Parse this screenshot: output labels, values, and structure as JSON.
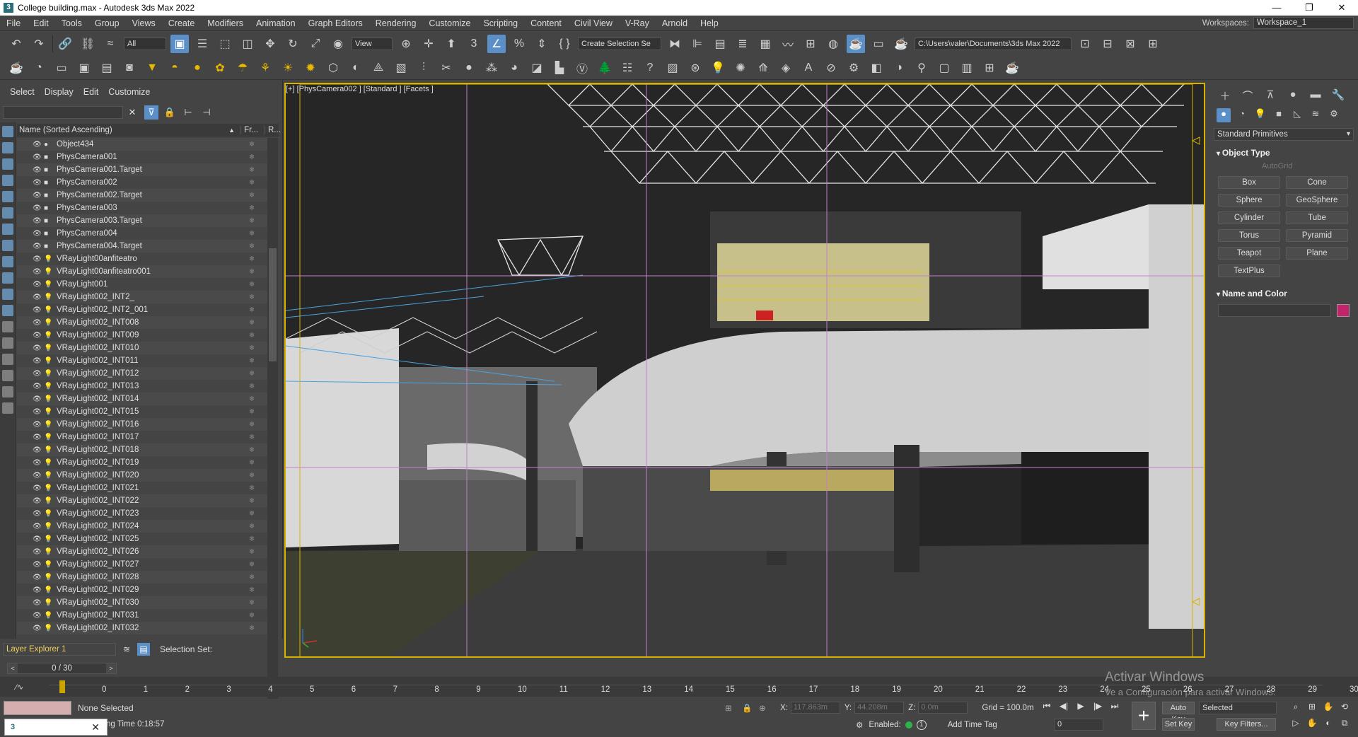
{
  "window": {
    "title": "College building.max - Autodesk 3ds Max 2022",
    "icon_label": "3",
    "controls": [
      "—",
      "❐",
      "✕"
    ]
  },
  "menu": {
    "items": [
      "File",
      "Edit",
      "Tools",
      "Group",
      "Views",
      "Create",
      "Modifiers",
      "Animation",
      "Graph Editors",
      "Rendering",
      "Customize",
      "Scripting",
      "Content",
      "Civil View",
      "V-Ray",
      "Arnold",
      "Help"
    ],
    "workspace_label": "Workspaces:",
    "workspace_value": "Workspace_1"
  },
  "toolbar": {
    "selection_filter": "All",
    "ref_coord": "View",
    "named_selection": "Create Selection Se",
    "project_path": "C:\\Users\\valer\\Documents\\3ds Max 2022"
  },
  "explorer": {
    "menu": [
      "Select",
      "Display",
      "Edit",
      "Customize"
    ],
    "search_value": "",
    "column_name": "Name (Sorted Ascending)",
    "column_frozen": "Fr...",
    "column_render": "R...",
    "rows": [
      {
        "name": "Object434",
        "kind": "geo"
      },
      {
        "name": "PhysCamera001",
        "kind": "cam"
      },
      {
        "name": "PhysCamera001.Target",
        "kind": "cam"
      },
      {
        "name": "PhysCamera002",
        "kind": "cam"
      },
      {
        "name": "PhysCamera002.Target",
        "kind": "cam"
      },
      {
        "name": "PhysCamera003",
        "kind": "cam"
      },
      {
        "name": "PhysCamera003.Target",
        "kind": "cam"
      },
      {
        "name": "PhysCamera004",
        "kind": "cam"
      },
      {
        "name": "PhysCamera004.Target",
        "kind": "cam"
      },
      {
        "name": "VRayLight00anfiteatro",
        "kind": "light"
      },
      {
        "name": "VRayLight00anfiteatro001",
        "kind": "light"
      },
      {
        "name": "VRayLight001",
        "kind": "light"
      },
      {
        "name": "VRayLight002_INT2_",
        "kind": "light"
      },
      {
        "name": "VRayLight002_INT2_001",
        "kind": "light"
      },
      {
        "name": "VRayLight002_INT008",
        "kind": "light"
      },
      {
        "name": "VRayLight002_INT009",
        "kind": "light"
      },
      {
        "name": "VRayLight002_INT010",
        "kind": "light"
      },
      {
        "name": "VRayLight002_INT011",
        "kind": "light"
      },
      {
        "name": "VRayLight002_INT012",
        "kind": "light"
      },
      {
        "name": "VRayLight002_INT013",
        "kind": "light"
      },
      {
        "name": "VRayLight002_INT014",
        "kind": "light"
      },
      {
        "name": "VRayLight002_INT015",
        "kind": "light"
      },
      {
        "name": "VRayLight002_INT016",
        "kind": "light"
      },
      {
        "name": "VRayLight002_INT017",
        "kind": "light"
      },
      {
        "name": "VRayLight002_INT018",
        "kind": "light"
      },
      {
        "name": "VRayLight002_INT019",
        "kind": "light"
      },
      {
        "name": "VRayLight002_INT020",
        "kind": "light"
      },
      {
        "name": "VRayLight002_INT021",
        "kind": "light"
      },
      {
        "name": "VRayLight002_INT022",
        "kind": "light"
      },
      {
        "name": "VRayLight002_INT023",
        "kind": "light"
      },
      {
        "name": "VRayLight002_INT024",
        "kind": "light"
      },
      {
        "name": "VRayLight002_INT025",
        "kind": "light"
      },
      {
        "name": "VRayLight002_INT026",
        "kind": "light"
      },
      {
        "name": "VRayLight002_INT027",
        "kind": "light"
      },
      {
        "name": "VRayLight002_INT028",
        "kind": "light"
      },
      {
        "name": "VRayLight002_INT029",
        "kind": "light"
      },
      {
        "name": "VRayLight002_INT030",
        "kind": "light"
      },
      {
        "name": "VRayLight002_INT031",
        "kind": "light"
      },
      {
        "name": "VRayLight002_INT032",
        "kind": "light"
      }
    ],
    "layer_explorer": "Layer Explorer 1",
    "selection_set_label": "Selection Set:"
  },
  "viewport": {
    "label": "[+] [PhysCamera002 ] [Standard ] [Facets ]",
    "border_color": "#d7b300"
  },
  "command_panel": {
    "category": "Standard Primitives",
    "object_type_title": "Object Type",
    "autogrid": "AutoGrid",
    "primitives": [
      "Box",
      "Cone",
      "Sphere",
      "GeoSphere",
      "Cylinder",
      "Tube",
      "Torus",
      "Pyramid",
      "Teapot",
      "Plane",
      "TextPlus"
    ],
    "name_color_title": "Name and Color",
    "object_name": "",
    "object_color": "#c2236a"
  },
  "timeline": {
    "frame_display": "0 / 30",
    "ticks": [
      "0",
      "1",
      "2",
      "3",
      "4",
      "5",
      "6",
      "7",
      "8",
      "9",
      "10",
      "11",
      "12",
      "13",
      "14",
      "15",
      "16",
      "17",
      "18",
      "19",
      "20",
      "21",
      "22",
      "23",
      "24",
      "25",
      "26",
      "27",
      "28",
      "29",
      "30"
    ]
  },
  "status": {
    "selection": "None Selected",
    "render_time": "ng Time  0:18:57",
    "x_label": "X:",
    "x_value": "117.863m",
    "y_label": "Y:",
    "y_value": "44.208m",
    "z_label": "Z:",
    "z_value": "0.0m",
    "grid": "Grid = 100.0m",
    "enabled_label": "Enabled:",
    "add_time_tag": "Add Time Tag",
    "current_frame": "0",
    "auto_key": "Auto Key",
    "set_key": "Set Key",
    "key_mode": "Selected",
    "key_filters": "Key Filters...",
    "watermark_line1": "Activar Windows",
    "watermark_line2": "Ve a Configuración para activar Windows."
  }
}
